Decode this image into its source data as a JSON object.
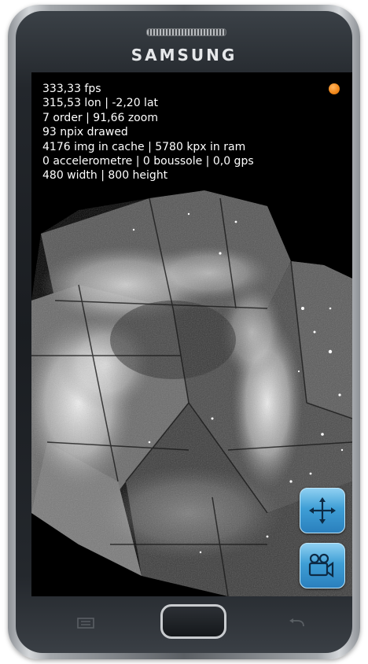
{
  "device": {
    "brand": "SAMSUNG"
  },
  "hud": {
    "lines": [
      "333,33 fps",
      "315,53 lon | -2,20 lat",
      "7 order | 91,66 zoom",
      "93 npix drawed",
      "4176 img in cache | 5780 kpx in ram",
      "0 accelerometre | 0 boussole | 0,0  gps",
      "480 width | 800 height"
    ]
  },
  "status": {
    "indicator_color": "#f28a1d"
  },
  "controls": {
    "pan_icon": "move-arrows-icon",
    "camera_icon": "camera-icon",
    "accent": "#3f9fd6"
  },
  "hardware_keys": {
    "menu_icon": "menu-icon",
    "home": "home-button",
    "back_icon": "back-arrow-icon"
  }
}
